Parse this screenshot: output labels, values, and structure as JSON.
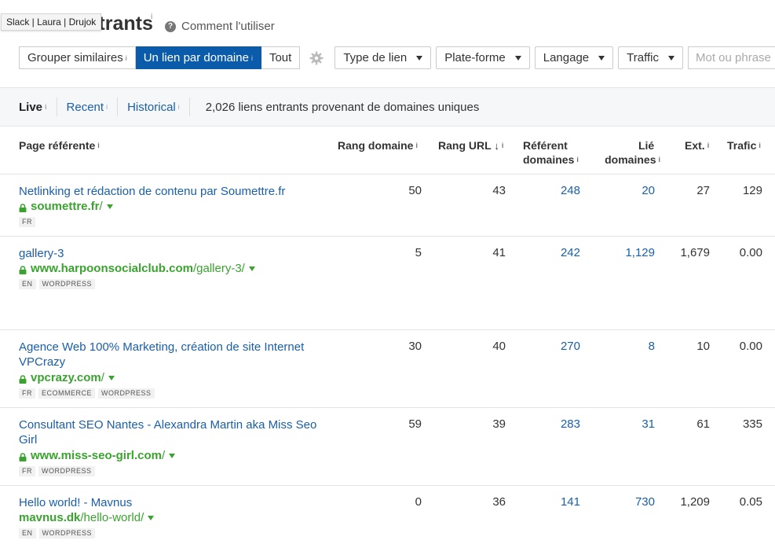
{
  "tooltip": "Slack | Laura | Drujok",
  "header": {
    "title": "Liens entrants",
    "title_sup": "i",
    "help_icon": "?",
    "help_link": "Comment l'utiliser"
  },
  "filters": {
    "group_options": [
      {
        "label": "Grouper similaires",
        "sup": "i"
      },
      {
        "label": "Un lien par domaine",
        "sup": "i"
      },
      {
        "label": "Tout",
        "sup": ""
      }
    ],
    "dropdowns": [
      "Type de lien",
      "Plate-forme",
      "Langage",
      "Traffic"
    ],
    "search_placeholder": "Mot ou phrase"
  },
  "tabs": [
    {
      "label": "Live",
      "sup": "i"
    },
    {
      "label": "Recent",
      "sup": "i"
    },
    {
      "label": "Historical",
      "sup": "i"
    }
  ],
  "summary": "2,026 liens entrants provenant de domaines uniques",
  "columns": {
    "page": "Page référente",
    "dr": "Rang domaine",
    "ur": "Rang URL",
    "ur_arrow": "↓",
    "ref_line1": "Référent",
    "ref_line2": "domaines",
    "linked_line1": "Lié",
    "linked_line2": "domaines",
    "ext": "Ext.",
    "traffic": "Trafic",
    "sup": "i"
  },
  "rows": [
    {
      "title": "Netlinking et rédaction de contenu par Soumettre.fr",
      "domain": "soumettre.fr",
      "path": "/",
      "tags": [
        "FR"
      ],
      "dr": "50",
      "ur": "43",
      "ref": "248",
      "linked": "20",
      "ext": "27",
      "traffic": "129"
    },
    {
      "title": "gallery-3",
      "domain": "www.harpoonsocialclub.com",
      "path": "/gallery-3/",
      "tags": [
        "EN",
        "WORDPRESS"
      ],
      "dr": "5",
      "ur": "41",
      "ref": "242",
      "linked": "1,129",
      "ext": "1,679",
      "traffic": "0.00"
    },
    {
      "title": "Agence Web 100% Marketing, création de site Internet VPCrazy",
      "domain": "vpcrazy.com",
      "path": "/",
      "tags": [
        "FR",
        "ECOMMERCE",
        "WORDPRESS"
      ],
      "dr": "30",
      "ur": "40",
      "ref": "270",
      "linked": "8",
      "ext": "10",
      "traffic": "0.00"
    },
    {
      "title": "Consultant SEO Nantes - Alexandra Martin aka Miss Seo Girl",
      "domain": "www.miss-seo-girl.com",
      "path": "/",
      "tags": [
        "FR",
        "WORDPRESS"
      ],
      "dr": "59",
      "ur": "39",
      "ref": "283",
      "linked": "31",
      "ext": "61",
      "traffic": "335"
    },
    {
      "title": "Hello world! - Mavnus",
      "domain": "mavnus.dk",
      "path": "/hello-world/",
      "tags": [
        "EN",
        "WORDPRESS"
      ],
      "dr": "0",
      "ur": "36",
      "ref": "141",
      "linked": "730",
      "ext": "1,209",
      "traffic": "0.05"
    }
  ],
  "colors": {
    "accent": "#0a5cab",
    "link": "#1a5fa8",
    "url_green": "#3aa32f"
  }
}
